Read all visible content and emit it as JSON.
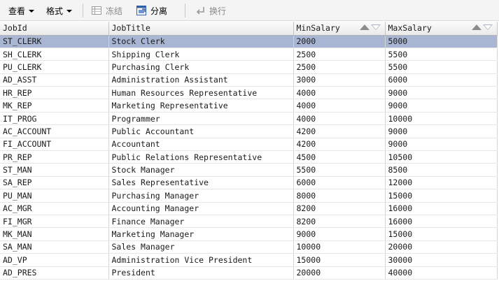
{
  "toolbar": {
    "view_label": "查看",
    "format_label": "格式",
    "freeze_label": "冻结",
    "detach_label": "分离",
    "wrap_label": "换行"
  },
  "table": {
    "columns": [
      "JobId",
      "JobTitle",
      "MinSalary",
      "MaxSalary"
    ],
    "selected_row_index": 0,
    "rows": [
      [
        "ST_CLERK",
        "Stock Clerk",
        "2000",
        "5000"
      ],
      [
        "SH_CLERK",
        "Shipping Clerk",
        "2500",
        "5500"
      ],
      [
        "PU_CLERK",
        "Purchasing Clerk",
        "2500",
        "5500"
      ],
      [
        "AD_ASST",
        "Administration Assistant",
        "3000",
        "6000"
      ],
      [
        "HR_REP",
        "Human Resources Representative",
        "4000",
        "9000"
      ],
      [
        "MK_REP",
        "Marketing Representative",
        "4000",
        "9000"
      ],
      [
        "IT_PROG",
        "Programmer",
        "4000",
        "10000"
      ],
      [
        "AC_ACCOUNT",
        "Public Accountant",
        "4200",
        "9000"
      ],
      [
        "FI_ACCOUNT",
        "Accountant",
        "4200",
        "9000"
      ],
      [
        "PR_REP",
        "Public Relations Representative",
        "4500",
        "10500"
      ],
      [
        "ST_MAN",
        "Stock Manager",
        "5500",
        "8500"
      ],
      [
        "SA_REP",
        "Sales Representative",
        "6000",
        "12000"
      ],
      [
        "PU_MAN",
        "Purchasing Manager",
        "8000",
        "15000"
      ],
      [
        "AC_MGR",
        "Accounting Manager",
        "8200",
        "16000"
      ],
      [
        "FI_MGR",
        "Finance Manager",
        "8200",
        "16000"
      ],
      [
        "MK_MAN",
        "Marketing Manager",
        "9000",
        "15000"
      ],
      [
        "SA_MAN",
        "Sales Manager",
        "10000",
        "20000"
      ],
      [
        "AD_VP",
        "Administration Vice President",
        "15000",
        "30000"
      ],
      [
        "AD_PRES",
        "President",
        "20000",
        "40000"
      ]
    ]
  },
  "colors": {
    "selection": "#a8b6d3",
    "toolbar_bg": "#f4f4f4",
    "detach_icon": "#2f5fa8"
  }
}
